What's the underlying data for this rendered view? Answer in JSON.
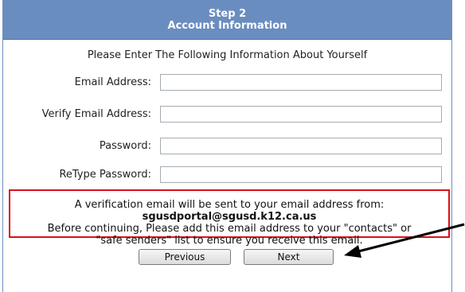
{
  "header": {
    "step": "Step 2",
    "title": "Account Information"
  },
  "intro": "Please Enter The Following Information About Yourself",
  "fields": [
    {
      "label": "Email Address:",
      "value": ""
    },
    {
      "label": "Verify Email Address:",
      "value": ""
    },
    {
      "label": "Password:",
      "value": ""
    },
    {
      "label": "ReType Password:",
      "value": ""
    }
  ],
  "notice": {
    "line1": "A verification email will be sent to your email address from:",
    "email": "sgusdportal@sgusd.k12.ca.us",
    "line2": "Before continuing, Please add this email address to your \"contacts\" or",
    "line3": "\"safe senders\" list to ensure you receive this email."
  },
  "buttons": {
    "previous": "Previous",
    "next": "Next"
  },
  "colors": {
    "header_bg": "#6a8dc0",
    "notice_border": "#d9111b",
    "arrow": "#000000"
  },
  "annotation": {
    "icon": "arrow-pointing-next-icon"
  }
}
